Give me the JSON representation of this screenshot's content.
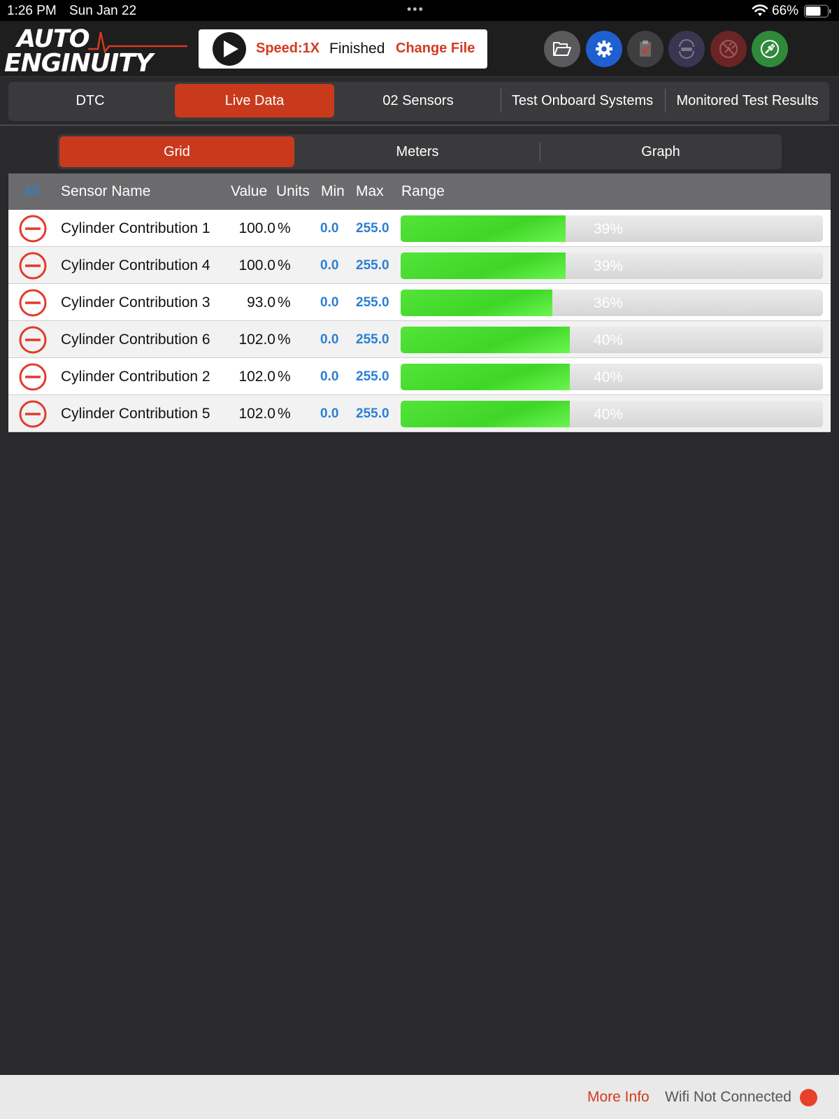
{
  "status_bar": {
    "time": "1:26 PM",
    "date": "Sun Jan 22",
    "dots": "•••",
    "battery": "66%"
  },
  "header": {
    "logo_top": "AUTO",
    "logo_bottom": "ENGINUITY",
    "player": {
      "speed": "Speed:1X",
      "state": "Finished",
      "change_file": "Change File"
    },
    "icons": [
      {
        "name": "open-folder-icon",
        "color": "#5a5a5c"
      },
      {
        "name": "settings-gear-icon",
        "color": "#1f5fd0"
      },
      {
        "name": "clipboard-check-icon",
        "color": "#3f3f41"
      },
      {
        "name": "vehicle-sync-icon",
        "color": "#3a3550"
      },
      {
        "name": "disconnected-plug-icon",
        "color": "#6a2424"
      },
      {
        "name": "connect-plug-icon",
        "color": "#2f8a3a"
      }
    ]
  },
  "tabs": [
    {
      "label": "DTC",
      "active": false
    },
    {
      "label": "Live Data",
      "active": true
    },
    {
      "label": "02 Sensors",
      "active": false
    },
    {
      "label": "Test Onboard Systems",
      "active": false
    },
    {
      "label": "Monitored Test Results",
      "active": false
    }
  ],
  "views": [
    {
      "label": "Grid",
      "active": true
    },
    {
      "label": "Meters",
      "active": false
    },
    {
      "label": "Graph",
      "active": false
    }
  ],
  "table": {
    "headers": {
      "all": "All",
      "sensor_name": "Sensor Name",
      "value": "Value",
      "units": "Units",
      "min": "Min",
      "max": "Max",
      "range": "Range"
    },
    "rows": [
      {
        "name": "Cylinder Contribution 1",
        "value": "100.0",
        "units": "%",
        "min": "0.0",
        "max": "255.0",
        "range_label": "39%",
        "range_fraction": 0.39
      },
      {
        "name": "Cylinder Contribution 4",
        "value": "100.0",
        "units": "%",
        "min": "0.0",
        "max": "255.0",
        "range_label": "39%",
        "range_fraction": 0.39
      },
      {
        "name": "Cylinder Contribution 3",
        "value": "93.0",
        "units": "%",
        "min": "0.0",
        "max": "255.0",
        "range_label": "36%",
        "range_fraction": 0.36
      },
      {
        "name": "Cylinder Contribution 6",
        "value": "102.0",
        "units": "%",
        "min": "0.0",
        "max": "255.0",
        "range_label": "40%",
        "range_fraction": 0.4
      },
      {
        "name": "Cylinder Contribution 2",
        "value": "102.0",
        "units": "%",
        "min": "0.0",
        "max": "255.0",
        "range_label": "40%",
        "range_fraction": 0.4
      },
      {
        "name": "Cylinder Contribution 5",
        "value": "102.0",
        "units": "%",
        "min": "0.0",
        "max": "255.0",
        "range_label": "40%",
        "range_fraction": 0.4
      }
    ]
  },
  "footer": {
    "more_info": "More Info",
    "wifi_status": "Wifi Not Connected",
    "status_color": "#e8402a"
  }
}
